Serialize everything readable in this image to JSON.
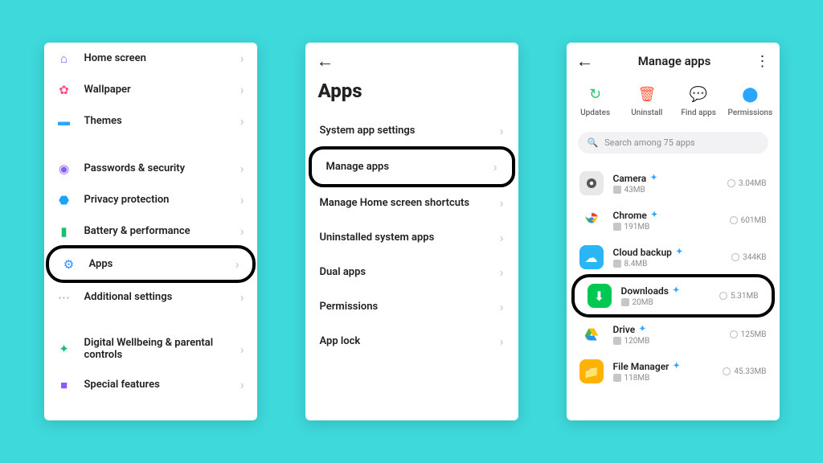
{
  "phone1": {
    "items": [
      {
        "label": "Home screen",
        "highlight": false
      },
      {
        "label": "Wallpaper",
        "highlight": false
      },
      {
        "label": "Themes",
        "highlight": false
      },
      {
        "label": "Passwords & security",
        "highlight": false
      },
      {
        "label": "Privacy protection",
        "highlight": false
      },
      {
        "label": "Battery & performance",
        "highlight": false
      },
      {
        "label": "Apps",
        "highlight": true
      },
      {
        "label": "Additional settings",
        "highlight": false
      },
      {
        "label": "Digital Wellbeing & parental controls",
        "highlight": false
      },
      {
        "label": "Special features",
        "highlight": false
      }
    ]
  },
  "phone2": {
    "title": "Apps",
    "items": [
      {
        "label": "System app settings",
        "highlight": false
      },
      {
        "label": "Manage apps",
        "highlight": true
      },
      {
        "label": "Manage Home screen shortcuts",
        "highlight": false
      },
      {
        "label": "Uninstalled system apps",
        "highlight": false
      },
      {
        "label": "Dual apps",
        "highlight": false
      },
      {
        "label": "Permissions",
        "highlight": false
      },
      {
        "label": "App lock",
        "highlight": false
      }
    ]
  },
  "phone3": {
    "title": "Manage apps",
    "actions": {
      "updates": "Updates",
      "uninstall": "Uninstall",
      "find": "Find apps",
      "permissions": "Permissions"
    },
    "search_placeholder": "Search among 75 apps",
    "apps": [
      {
        "name": "Camera",
        "mem": "43MB",
        "size": "3.04MB",
        "highlight": false
      },
      {
        "name": "Chrome",
        "mem": "191MB",
        "size": "601MB",
        "highlight": false
      },
      {
        "name": "Cloud backup",
        "mem": "8.4MB",
        "size": "344KB",
        "highlight": false
      },
      {
        "name": "Downloads",
        "mem": "20MB",
        "size": "5.31MB",
        "highlight": true
      },
      {
        "name": "Drive",
        "mem": "120MB",
        "size": "125MB",
        "highlight": false
      },
      {
        "name": "File Manager",
        "mem": "118MB",
        "size": "45.33MB",
        "highlight": false
      }
    ]
  }
}
